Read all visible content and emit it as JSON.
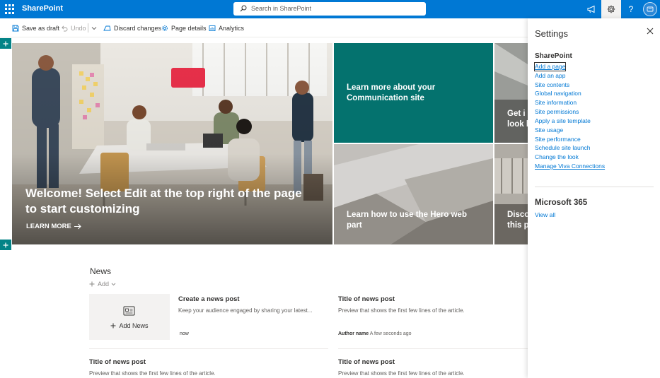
{
  "suitebar": {
    "brand": "SharePoint",
    "search_placeholder": "Search in SharePoint",
    "icons": [
      "waffle-icon",
      "megaphone-icon",
      "gear-icon",
      "help-icon",
      "avatar"
    ],
    "accent": "#0078d4"
  },
  "commandbar": {
    "save_draft": "Save as draft",
    "undo": "Undo",
    "discard": "Discard changes",
    "page_details": "Page details",
    "analytics": "Analytics"
  },
  "hero": {
    "main_title": "Welcome! Select Edit at the top right of the page to start customizing",
    "learn_more": "LEARN MORE",
    "tile_teal": "Learn more about your Communication site",
    "tile_top_right": "Get i\nlook b",
    "tile_bottom": "Learn how to use the Hero web part",
    "tile_bottom_right": "Disco\nthis p",
    "teal_color": "#04726e"
  },
  "news": {
    "title": "News",
    "add": "Add",
    "add_news": "Add News",
    "posts": [
      {
        "title": "Create a news post",
        "desc": "Keep your audience engaged by sharing your latest...",
        "author": "",
        "time": "now"
      },
      {
        "title": "Title of news post",
        "desc": "Preview that shows the first few lines of the article.",
        "author": "Author name",
        "time": "A few seconds ago"
      },
      {
        "title": "Title of news post",
        "desc": "Preview that shows the first few lines of the article."
      },
      {
        "title": "Title of news post",
        "desc": "Preview that shows the first few lines of the article."
      }
    ]
  },
  "settings": {
    "title": "Settings",
    "sharepoint_heading": "SharePoint",
    "links": [
      "Add a page",
      "Add an app",
      "Site contents",
      "Global navigation",
      "Site information",
      "Site permissions",
      "Apply a site template",
      "Site usage",
      "Site performance",
      "Schedule site launch",
      "Change the look",
      "Manage Viva Connections"
    ],
    "m365_heading": "Microsoft 365",
    "view_all": "View all"
  }
}
